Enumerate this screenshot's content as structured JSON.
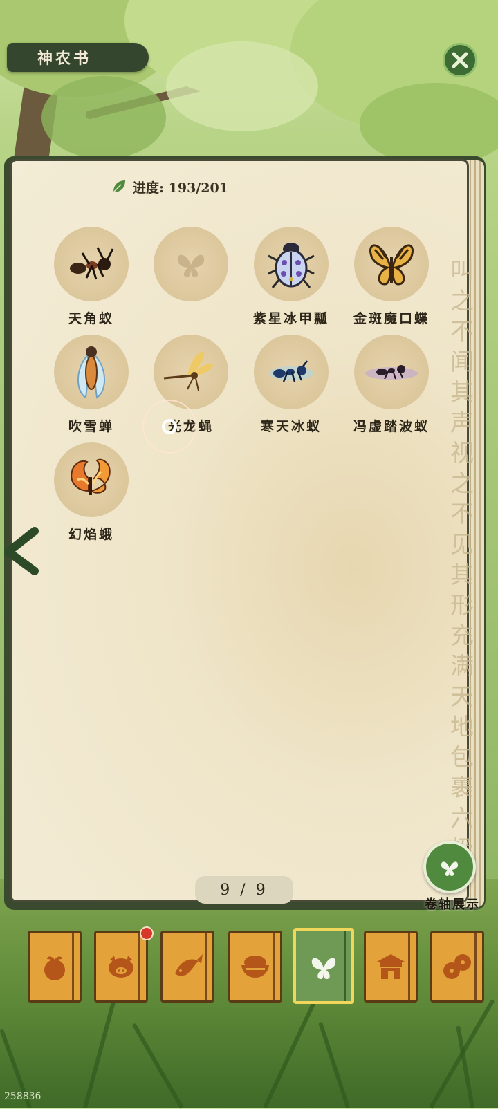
{
  "header": {
    "title": "神农书"
  },
  "progress": {
    "label": "进度: 193/201"
  },
  "items": [
    {
      "name": "天角蚁",
      "icon": "ant-icon"
    },
    {
      "name": "",
      "icon": "locked-butterfly-icon"
    },
    {
      "name": "紫星冰甲瓢",
      "icon": "ladybug-icon"
    },
    {
      "name": "金斑魔口蝶",
      "icon": "butterfly-icon"
    },
    {
      "name": "吹雪蝉",
      "icon": "cicada-icon"
    },
    {
      "name": "光龙蝇",
      "icon": "dragonfly-icon"
    },
    {
      "name": "寒天冰蚁",
      "icon": "ice-ant-icon"
    },
    {
      "name": "冯虚踏波蚁",
      "icon": "water-ant-icon"
    },
    {
      "name": "幻焰蛾",
      "icon": "flame-moth-icon"
    }
  ],
  "calligraphy": "叫之不闻其声视之不见其形充满天地包裹六极",
  "pagination": {
    "text": "9 / 9"
  },
  "scroll_display": {
    "label": "卷轴展示"
  },
  "tabs": [
    {
      "icon": "fruit-icon"
    },
    {
      "icon": "pig-icon"
    },
    {
      "icon": "fish-icon"
    },
    {
      "icon": "rice-bowl-icon"
    },
    {
      "icon": "butterfly-icon",
      "active": true
    },
    {
      "icon": "house-icon"
    },
    {
      "icon": "beans-icon"
    }
  ],
  "watermark": "258836",
  "colors": {
    "accent": "#4f8a3e",
    "tab": "#e4a23a",
    "active_tab": "#6f9a56",
    "badge": "#d7362b"
  }
}
